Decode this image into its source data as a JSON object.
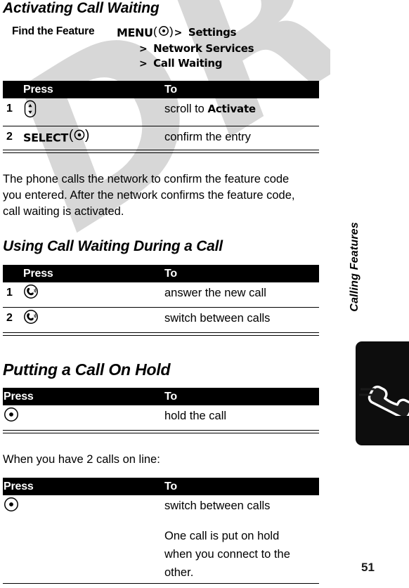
{
  "document": {
    "page_number": "51",
    "watermark": "DRAFT",
    "sidebar_label": "Calling Features"
  },
  "sections": [
    {
      "title": "Activating Call Waiting",
      "find_the_feature": {
        "label": "Find the Feature",
        "lines": [
          {
            "prefix": "MENU",
            "key_icon": "center-select-key-icon",
            "separator": ">",
            "target": "Settings"
          },
          {
            "prefix": "",
            "key_icon": "",
            "separator": ">",
            "target": "Network Services"
          },
          {
            "prefix": "",
            "key_icon": "",
            "separator": ">",
            "target": "Call Waiting"
          }
        ]
      },
      "table": {
        "headers": {
          "num": "",
          "press": "Press",
          "to": "To"
        },
        "rows": [
          {
            "num": "1",
            "press_icon": "scroll-key-icon",
            "press_label": "",
            "to_plain": "scroll to ",
            "to_bold": "Activate"
          },
          {
            "num": "2",
            "press_icon": "center-select-key-icon",
            "press_label": "SELECT",
            "to_plain": "confirm the entry",
            "to_bold": ""
          }
        ]
      },
      "paragraph": "The phone calls the network to confirm the feature code you entered. After the network confirms the feature code, call waiting is activated."
    },
    {
      "title": "Using Call Waiting During a Call",
      "table": {
        "headers": {
          "num": "",
          "press": "Press",
          "to": "To"
        },
        "rows": [
          {
            "num": "1",
            "press_icon": "send-key-icon",
            "press_label": "",
            "to_plain": "answer the new call",
            "to_bold": ""
          },
          {
            "num": "2",
            "press_icon": "send-key-icon",
            "press_label": "",
            "to_plain": "switch between calls",
            "to_bold": ""
          }
        ]
      }
    },
    {
      "title": "Putting a Call On Hold",
      "table": {
        "headers": {
          "press": "Press",
          "to": "To"
        },
        "rows": [
          {
            "press_icon": "center-select-key-icon",
            "to_plain": "hold the call"
          }
        ]
      },
      "paragraph": "When you have 2 calls on line:",
      "table2": {
        "headers": {
          "press": "Press",
          "to": "To"
        },
        "rows": [
          {
            "press_icon": "center-select-key-icon",
            "to_plain": "switch between calls"
          },
          {
            "press_icon": "",
            "to_plain": "One call is put on hold when you connect to the other."
          }
        ]
      }
    }
  ]
}
